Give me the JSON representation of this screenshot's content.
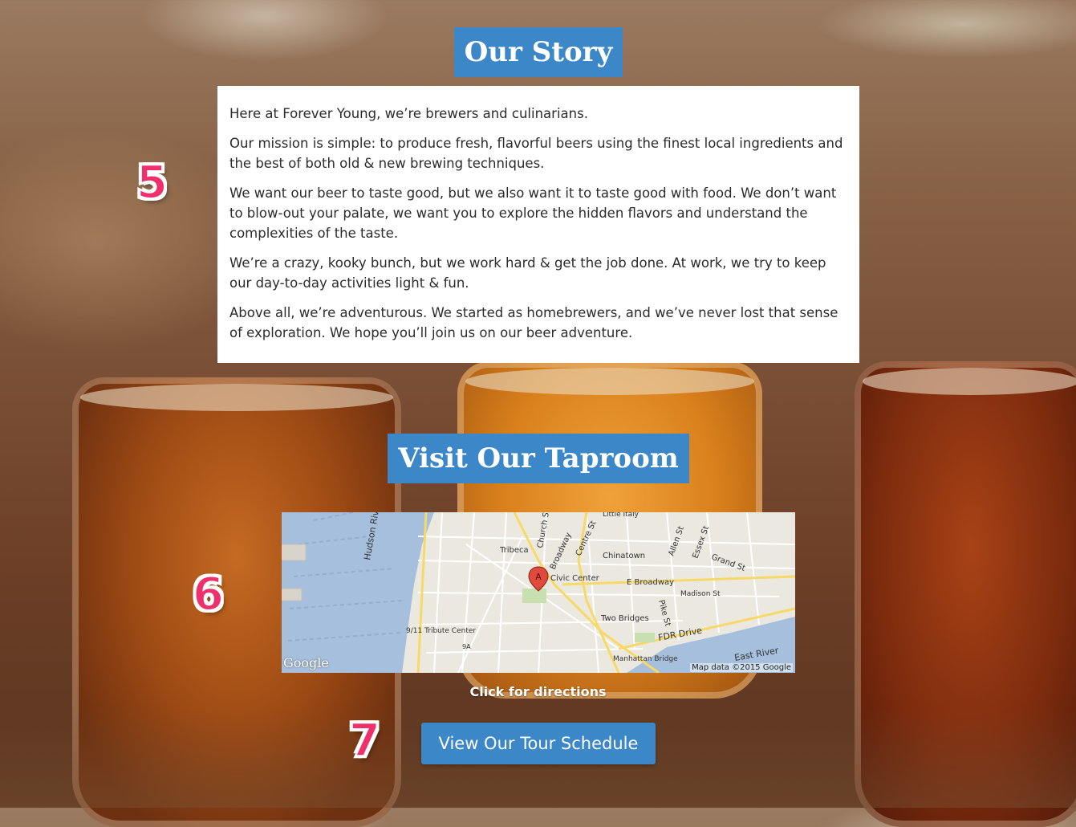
{
  "story": {
    "title": "Our Story",
    "paragraphs": [
      "Here at Forever Young, we’re brewers and culinarians.",
      "Our mission is simple: to produce fresh, flavorful beers using the finest local ingredients and the best of both old & new brewing techniques.",
      "We want our beer to taste good, but we also want it to taste good with food. We don’t want to blow-out your palate, we want you to explore the hidden flavors and understand the complexities of the taste.",
      "We’re a crazy, kooky bunch, but we work hard & get the job done. At work, we try to keep our day-to-day activities light & fun.",
      "Above all, we’re adventurous. We started as homebrewers, and we’ve never lost that sense of exploration. We hope you’ll join us on our beer adventure."
    ]
  },
  "taproom": {
    "title": "Visit Our Taproom",
    "map": {
      "marker_letter": "A",
      "attribution": "Map data ©2015 Google",
      "logo": "Google",
      "labels": {
        "hudson": "Hudson River",
        "tribeca": "Tribeca",
        "church": "Church St",
        "broadway": "Broadway",
        "centre": "Centre St",
        "little_italy": "Little Italy",
        "chinatown": "Chinatown",
        "allen": "Allen St",
        "essex": "Essex St",
        "grand": "Grand St",
        "civic": "Civic Center",
        "ebroadway": "E Broadway",
        "madison": "Madison St",
        "pike": "Pike St",
        "two_bridges": "Two Bridges",
        "tribute": "9/11 Tribute Center",
        "fdr": "FDR Drive",
        "manhattan_bridge": "Manhattan Bridge",
        "east_river": "East River",
        "hudson_short": "Hudso",
        "route_9a": "9A"
      }
    },
    "directions_label": "Click for directions"
  },
  "tour_button_label": "View Our Tour Schedule",
  "annotations": [
    "5",
    "6",
    "7"
  ],
  "colors": {
    "accent": "#3c87c8",
    "annotation": "#f0306a"
  }
}
